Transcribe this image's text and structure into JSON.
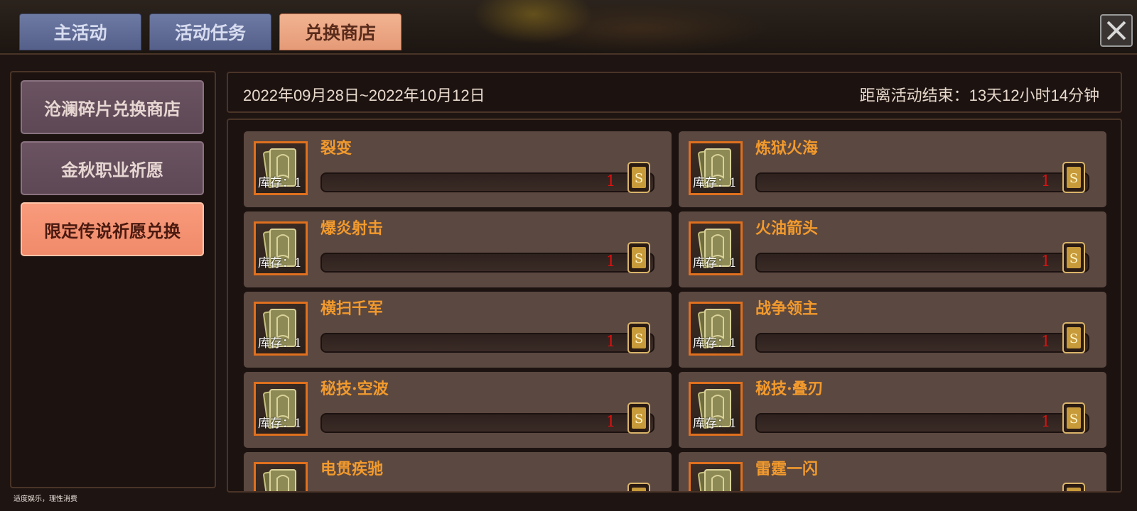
{
  "tabs": [
    {
      "label": "主活动",
      "active": false
    },
    {
      "label": "活动任务",
      "active": false
    },
    {
      "label": "兑换商店",
      "active": true
    }
  ],
  "sidebar": {
    "items": [
      {
        "label": "沧澜碎片兑换商店",
        "selected": false
      },
      {
        "label": "金秋职业祈愿",
        "selected": false
      },
      {
        "label": "限定传说祈愿兑换",
        "selected": true
      }
    ]
  },
  "header": {
    "date_range": "2022年09月28日~2022年10月12日",
    "countdown": "距离活动结束：13天12小时14分钟"
  },
  "items": [
    {
      "name": "裂变",
      "stock": "库存：1",
      "cost": "1"
    },
    {
      "name": "炼狱火海",
      "stock": "库存：1",
      "cost": "1"
    },
    {
      "name": "爆炎射击",
      "stock": "库存：1",
      "cost": "1"
    },
    {
      "name": "火油箭头",
      "stock": "库存：1",
      "cost": "1"
    },
    {
      "name": "横扫千军",
      "stock": "库存：1",
      "cost": "1"
    },
    {
      "name": "战争领主",
      "stock": "库存：1",
      "cost": "1"
    },
    {
      "name": "秘技·空波",
      "stock": "库存：1",
      "cost": "1"
    },
    {
      "name": "秘技·叠刃",
      "stock": "库存：1",
      "cost": "1"
    },
    {
      "name": "电贯疾驰",
      "stock": "",
      "cost": ""
    },
    {
      "name": "雷霆一闪",
      "stock": "",
      "cost": ""
    }
  ],
  "footer": {
    "disclaimer": "适度娱乐，理性消费"
  },
  "icons": {
    "close": "close-icon",
    "item": "card-icon",
    "currency": "token-icon"
  },
  "colors": {
    "tab_inactive": "#5f6b96",
    "tab_active": "#eda584",
    "sidebar_selected": "#f4907a",
    "item_name": "#f29a2d",
    "cost": "#e01010"
  }
}
